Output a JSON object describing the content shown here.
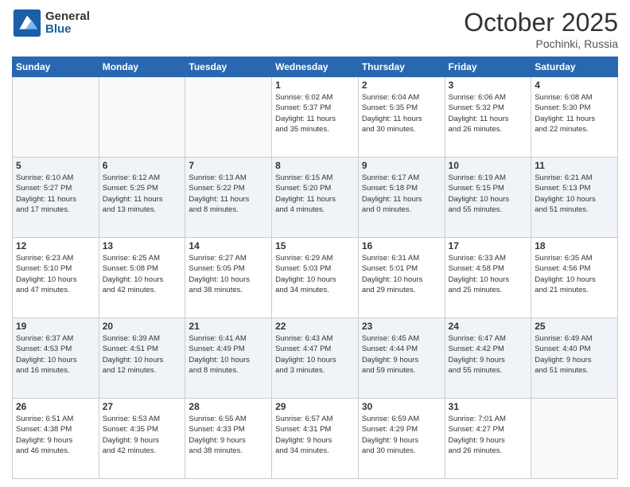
{
  "header": {
    "logo_general": "General",
    "logo_blue": "Blue",
    "month_title": "October 2025",
    "location": "Pochinki, Russia"
  },
  "days_of_week": [
    "Sunday",
    "Monday",
    "Tuesday",
    "Wednesday",
    "Thursday",
    "Friday",
    "Saturday"
  ],
  "weeks": [
    {
      "shaded": false,
      "days": [
        {
          "num": "",
          "info": ""
        },
        {
          "num": "",
          "info": ""
        },
        {
          "num": "",
          "info": ""
        },
        {
          "num": "1",
          "info": "Sunrise: 6:02 AM\nSunset: 5:37 PM\nDaylight: 11 hours\nand 35 minutes."
        },
        {
          "num": "2",
          "info": "Sunrise: 6:04 AM\nSunset: 5:35 PM\nDaylight: 11 hours\nand 30 minutes."
        },
        {
          "num": "3",
          "info": "Sunrise: 6:06 AM\nSunset: 5:32 PM\nDaylight: 11 hours\nand 26 minutes."
        },
        {
          "num": "4",
          "info": "Sunrise: 6:08 AM\nSunset: 5:30 PM\nDaylight: 11 hours\nand 22 minutes."
        }
      ]
    },
    {
      "shaded": true,
      "days": [
        {
          "num": "5",
          "info": "Sunrise: 6:10 AM\nSunset: 5:27 PM\nDaylight: 11 hours\nand 17 minutes."
        },
        {
          "num": "6",
          "info": "Sunrise: 6:12 AM\nSunset: 5:25 PM\nDaylight: 11 hours\nand 13 minutes."
        },
        {
          "num": "7",
          "info": "Sunrise: 6:13 AM\nSunset: 5:22 PM\nDaylight: 11 hours\nand 8 minutes."
        },
        {
          "num": "8",
          "info": "Sunrise: 6:15 AM\nSunset: 5:20 PM\nDaylight: 11 hours\nand 4 minutes."
        },
        {
          "num": "9",
          "info": "Sunrise: 6:17 AM\nSunset: 5:18 PM\nDaylight: 11 hours\nand 0 minutes."
        },
        {
          "num": "10",
          "info": "Sunrise: 6:19 AM\nSunset: 5:15 PM\nDaylight: 10 hours\nand 55 minutes."
        },
        {
          "num": "11",
          "info": "Sunrise: 6:21 AM\nSunset: 5:13 PM\nDaylight: 10 hours\nand 51 minutes."
        }
      ]
    },
    {
      "shaded": false,
      "days": [
        {
          "num": "12",
          "info": "Sunrise: 6:23 AM\nSunset: 5:10 PM\nDaylight: 10 hours\nand 47 minutes."
        },
        {
          "num": "13",
          "info": "Sunrise: 6:25 AM\nSunset: 5:08 PM\nDaylight: 10 hours\nand 42 minutes."
        },
        {
          "num": "14",
          "info": "Sunrise: 6:27 AM\nSunset: 5:05 PM\nDaylight: 10 hours\nand 38 minutes."
        },
        {
          "num": "15",
          "info": "Sunrise: 6:29 AM\nSunset: 5:03 PM\nDaylight: 10 hours\nand 34 minutes."
        },
        {
          "num": "16",
          "info": "Sunrise: 6:31 AM\nSunset: 5:01 PM\nDaylight: 10 hours\nand 29 minutes."
        },
        {
          "num": "17",
          "info": "Sunrise: 6:33 AM\nSunset: 4:58 PM\nDaylight: 10 hours\nand 25 minutes."
        },
        {
          "num": "18",
          "info": "Sunrise: 6:35 AM\nSunset: 4:56 PM\nDaylight: 10 hours\nand 21 minutes."
        }
      ]
    },
    {
      "shaded": true,
      "days": [
        {
          "num": "19",
          "info": "Sunrise: 6:37 AM\nSunset: 4:53 PM\nDaylight: 10 hours\nand 16 minutes."
        },
        {
          "num": "20",
          "info": "Sunrise: 6:39 AM\nSunset: 4:51 PM\nDaylight: 10 hours\nand 12 minutes."
        },
        {
          "num": "21",
          "info": "Sunrise: 6:41 AM\nSunset: 4:49 PM\nDaylight: 10 hours\nand 8 minutes."
        },
        {
          "num": "22",
          "info": "Sunrise: 6:43 AM\nSunset: 4:47 PM\nDaylight: 10 hours\nand 3 minutes."
        },
        {
          "num": "23",
          "info": "Sunrise: 6:45 AM\nSunset: 4:44 PM\nDaylight: 9 hours\nand 59 minutes."
        },
        {
          "num": "24",
          "info": "Sunrise: 6:47 AM\nSunset: 4:42 PM\nDaylight: 9 hours\nand 55 minutes."
        },
        {
          "num": "25",
          "info": "Sunrise: 6:49 AM\nSunset: 4:40 PM\nDaylight: 9 hours\nand 51 minutes."
        }
      ]
    },
    {
      "shaded": false,
      "days": [
        {
          "num": "26",
          "info": "Sunrise: 6:51 AM\nSunset: 4:38 PM\nDaylight: 9 hours\nand 46 minutes."
        },
        {
          "num": "27",
          "info": "Sunrise: 6:53 AM\nSunset: 4:35 PM\nDaylight: 9 hours\nand 42 minutes."
        },
        {
          "num": "28",
          "info": "Sunrise: 6:55 AM\nSunset: 4:33 PM\nDaylight: 9 hours\nand 38 minutes."
        },
        {
          "num": "29",
          "info": "Sunrise: 6:57 AM\nSunset: 4:31 PM\nDaylight: 9 hours\nand 34 minutes."
        },
        {
          "num": "30",
          "info": "Sunrise: 6:59 AM\nSunset: 4:29 PM\nDaylight: 9 hours\nand 30 minutes."
        },
        {
          "num": "31",
          "info": "Sunrise: 7:01 AM\nSunset: 4:27 PM\nDaylight: 9 hours\nand 26 minutes."
        },
        {
          "num": "",
          "info": ""
        }
      ]
    }
  ]
}
